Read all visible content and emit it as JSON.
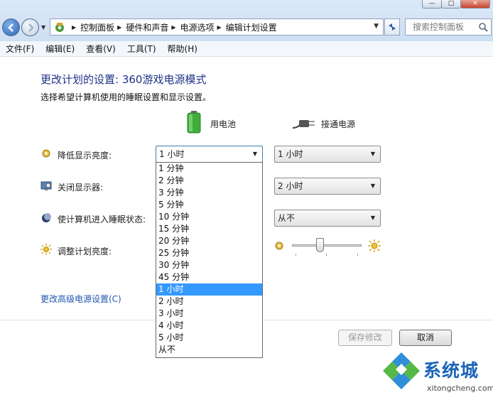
{
  "window": {
    "minimize": "—",
    "maximize": "□",
    "close": "✕"
  },
  "address_bar": {
    "crumbs": [
      "控制面板",
      "硬件和声音",
      "电源选项",
      "编辑计划设置"
    ]
  },
  "search": {
    "placeholder": "搜索控制面板"
  },
  "menu": [
    "文件(F)",
    "编辑(E)",
    "查看(V)",
    "工具(T)",
    "帮助(H)"
  ],
  "page": {
    "title": "更改计划的设置: 360游戏电源模式",
    "subtitle": "选择希望计算机使用的睡眠设置和显示设置。",
    "battery_label": "用电池",
    "power_label": "接通电源"
  },
  "settings": [
    {
      "label": "降低显示亮度:",
      "battery": "1 小时",
      "power": "1 小时"
    },
    {
      "label": "关闭显示器:",
      "battery": "",
      "power": "2 小时"
    },
    {
      "label": "使计算机进入睡眠状态:",
      "battery": "",
      "power": "从不"
    },
    {
      "label": "调整计划亮度:",
      "brightness_level": 0.4
    }
  ],
  "dropdown": {
    "options": [
      "1 分钟",
      "2 分钟",
      "3 分钟",
      "5 分钟",
      "10 分钟",
      "15 分钟",
      "20 分钟",
      "25 分钟",
      "30 分钟",
      "45 分钟",
      "1 小时",
      "2 小时",
      "3 小时",
      "4 小时",
      "5 小时",
      "从不"
    ],
    "selected_index": 10
  },
  "advanced_link": "更改高级电源设置(C)",
  "buttons": {
    "save": "保存修改",
    "cancel": "取消"
  },
  "watermark": {
    "title": "系统城",
    "url": "xitongcheng.com"
  },
  "colors": {
    "title_blue": "#1e3287",
    "link_blue": "#2056b1",
    "selection": "#3399ff"
  }
}
